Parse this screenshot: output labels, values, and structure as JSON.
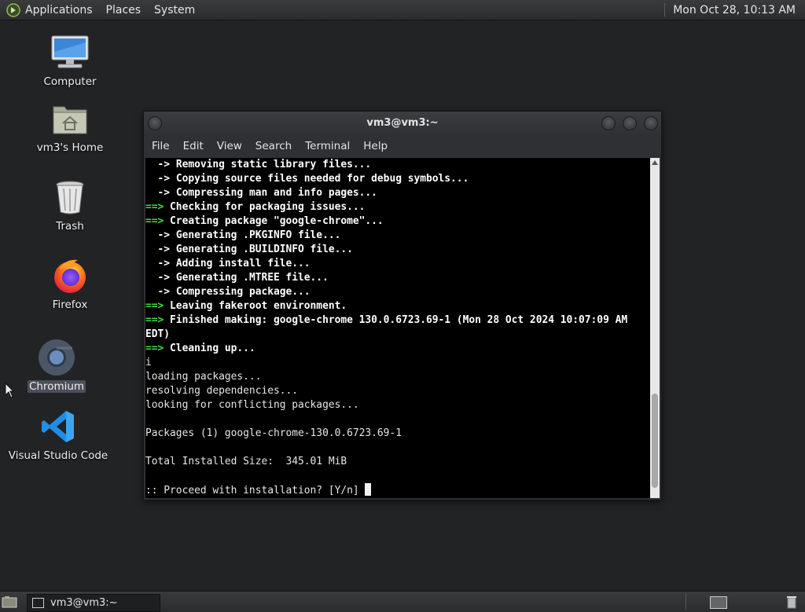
{
  "top_panel": {
    "menus": [
      "Applications",
      "Places",
      "System"
    ],
    "clock": "Mon Oct 28, 10:13 AM"
  },
  "desktop_icons": [
    {
      "label": "Computer",
      "icon": "computer-icon"
    },
    {
      "label": "vm3's Home",
      "icon": "home-folder-icon"
    },
    {
      "label": "Trash",
      "icon": "trash-icon"
    },
    {
      "label": "Firefox",
      "icon": "firefox-icon"
    },
    {
      "label": "Chromium",
      "icon": "chromium-icon",
      "selected": true
    },
    {
      "label": "Visual Studio Code",
      "icon": "vscode-icon"
    }
  ],
  "terminal": {
    "title": "vm3@vm3:~",
    "menu": [
      "File",
      "Edit",
      "View",
      "Search",
      "Terminal",
      "Help"
    ],
    "lines": [
      {
        "prefix": "  -> ",
        "text": "Removing static library files...",
        "style": "arrow"
      },
      {
        "prefix": "  -> ",
        "text": "Copying source files needed for debug symbols...",
        "style": "arrow"
      },
      {
        "prefix": "  -> ",
        "text": "Compressing man and info pages...",
        "style": "arrow"
      },
      {
        "prefix": "==> ",
        "text": "Checking for packaging issues...",
        "style": "stage"
      },
      {
        "prefix": "==> ",
        "text": "Creating package \"google-chrome\"...",
        "style": "stage"
      },
      {
        "prefix": "  -> ",
        "text": "Generating .PKGINFO file...",
        "style": "arrow"
      },
      {
        "prefix": "  -> ",
        "text": "Generating .BUILDINFO file...",
        "style": "arrow"
      },
      {
        "prefix": "  -> ",
        "text": "Adding install file...",
        "style": "arrow"
      },
      {
        "prefix": "  -> ",
        "text": "Generating .MTREE file...",
        "style": "arrow"
      },
      {
        "prefix": "  -> ",
        "text": "Compressing package...",
        "style": "arrow"
      },
      {
        "prefix": "==> ",
        "text": "Leaving fakeroot environment.",
        "style": "stage"
      },
      {
        "prefix": "==> ",
        "text": "Finished making: google-chrome 130.0.6723.69-1 (Mon 28 Oct 2024 10:07:09 AM",
        "style": "stage"
      },
      {
        "prefix": "",
        "text": "EDT)",
        "style": "boldplain"
      },
      {
        "prefix": "==> ",
        "text": "Cleaning up...",
        "style": "stage"
      },
      {
        "prefix": "",
        "text": "i",
        "style": "plain"
      },
      {
        "prefix": "",
        "text": "loading packages...",
        "style": "plain"
      },
      {
        "prefix": "",
        "text": "resolving dependencies...",
        "style": "plain"
      },
      {
        "prefix": "",
        "text": "looking for conflicting packages...",
        "style": "plain"
      },
      {
        "prefix": "",
        "text": "",
        "style": "plain"
      },
      {
        "prefix": "",
        "text": "Packages (1) google-chrome-130.0.6723.69-1",
        "style": "plain"
      },
      {
        "prefix": "",
        "text": "",
        "style": "plain"
      },
      {
        "prefix": "",
        "text": "Total Installed Size:  345.01 MiB",
        "style": "plain"
      },
      {
        "prefix": "",
        "text": "",
        "style": "plain"
      },
      {
        "prefix": "",
        "text": ":: Proceed with installation? [Y/n] ",
        "style": "prompt"
      }
    ]
  },
  "bottom_panel": {
    "task_label": "vm3@vm3:~"
  }
}
